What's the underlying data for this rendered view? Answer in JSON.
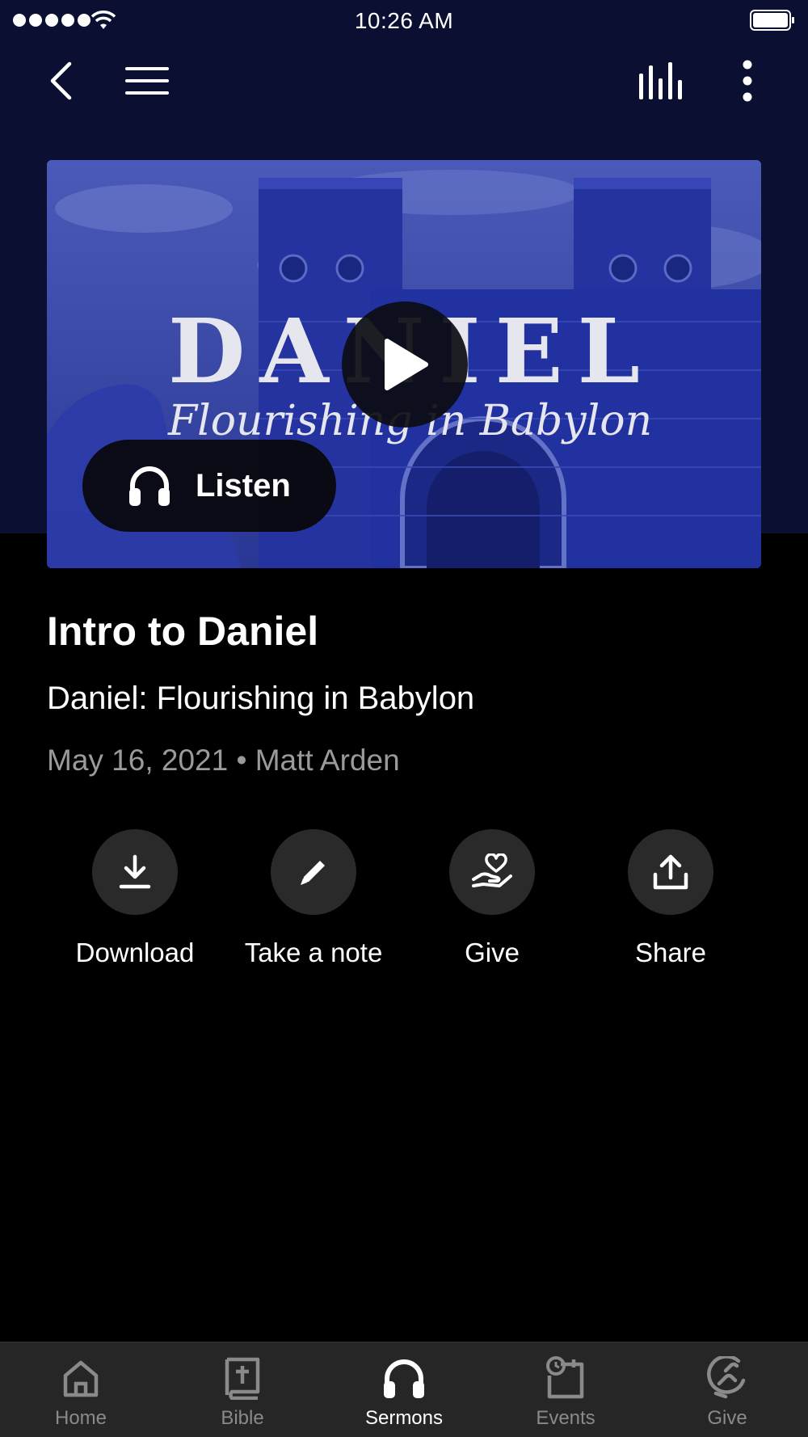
{
  "status_bar": {
    "time": "10:26 AM"
  },
  "nav": {
    "back_icon": "chevron-left-icon",
    "menu_icon": "hamburger-menu-icon",
    "live_icon": "audio-bars-icon",
    "more_icon": "vertical-dots-icon"
  },
  "hero": {
    "artwork_title": "DANIEL",
    "artwork_subtitle": "Flourishing in Babylon",
    "listen_label": "Listen"
  },
  "sermon": {
    "title": "Intro to Daniel",
    "series": "Daniel: Flourishing in Babylon",
    "meta": "May 16, 2021 • Matt Arden"
  },
  "actions": [
    {
      "label": "Download",
      "icon": "download-icon"
    },
    {
      "label": "Take a note",
      "icon": "pencil-icon"
    },
    {
      "label": "Give",
      "icon": "heart-hand-icon"
    },
    {
      "label": "Share",
      "icon": "share-icon"
    }
  ],
  "tabs": [
    {
      "label": "Home",
      "icon": "home-icon",
      "active": false
    },
    {
      "label": "Bible",
      "icon": "bible-icon",
      "active": false
    },
    {
      "label": "Sermons",
      "icon": "headphones-icon",
      "active": true
    },
    {
      "label": "Events",
      "icon": "calendar-clock-icon",
      "active": false
    },
    {
      "label": "Give",
      "icon": "give-icon",
      "active": false
    }
  ],
  "colors": {
    "header_background": "#0b1033",
    "page_background": "#000000",
    "tab_bar_background": "#262626",
    "action_circle": "#2a2a2a",
    "meta_text": "#9a9a9a"
  }
}
